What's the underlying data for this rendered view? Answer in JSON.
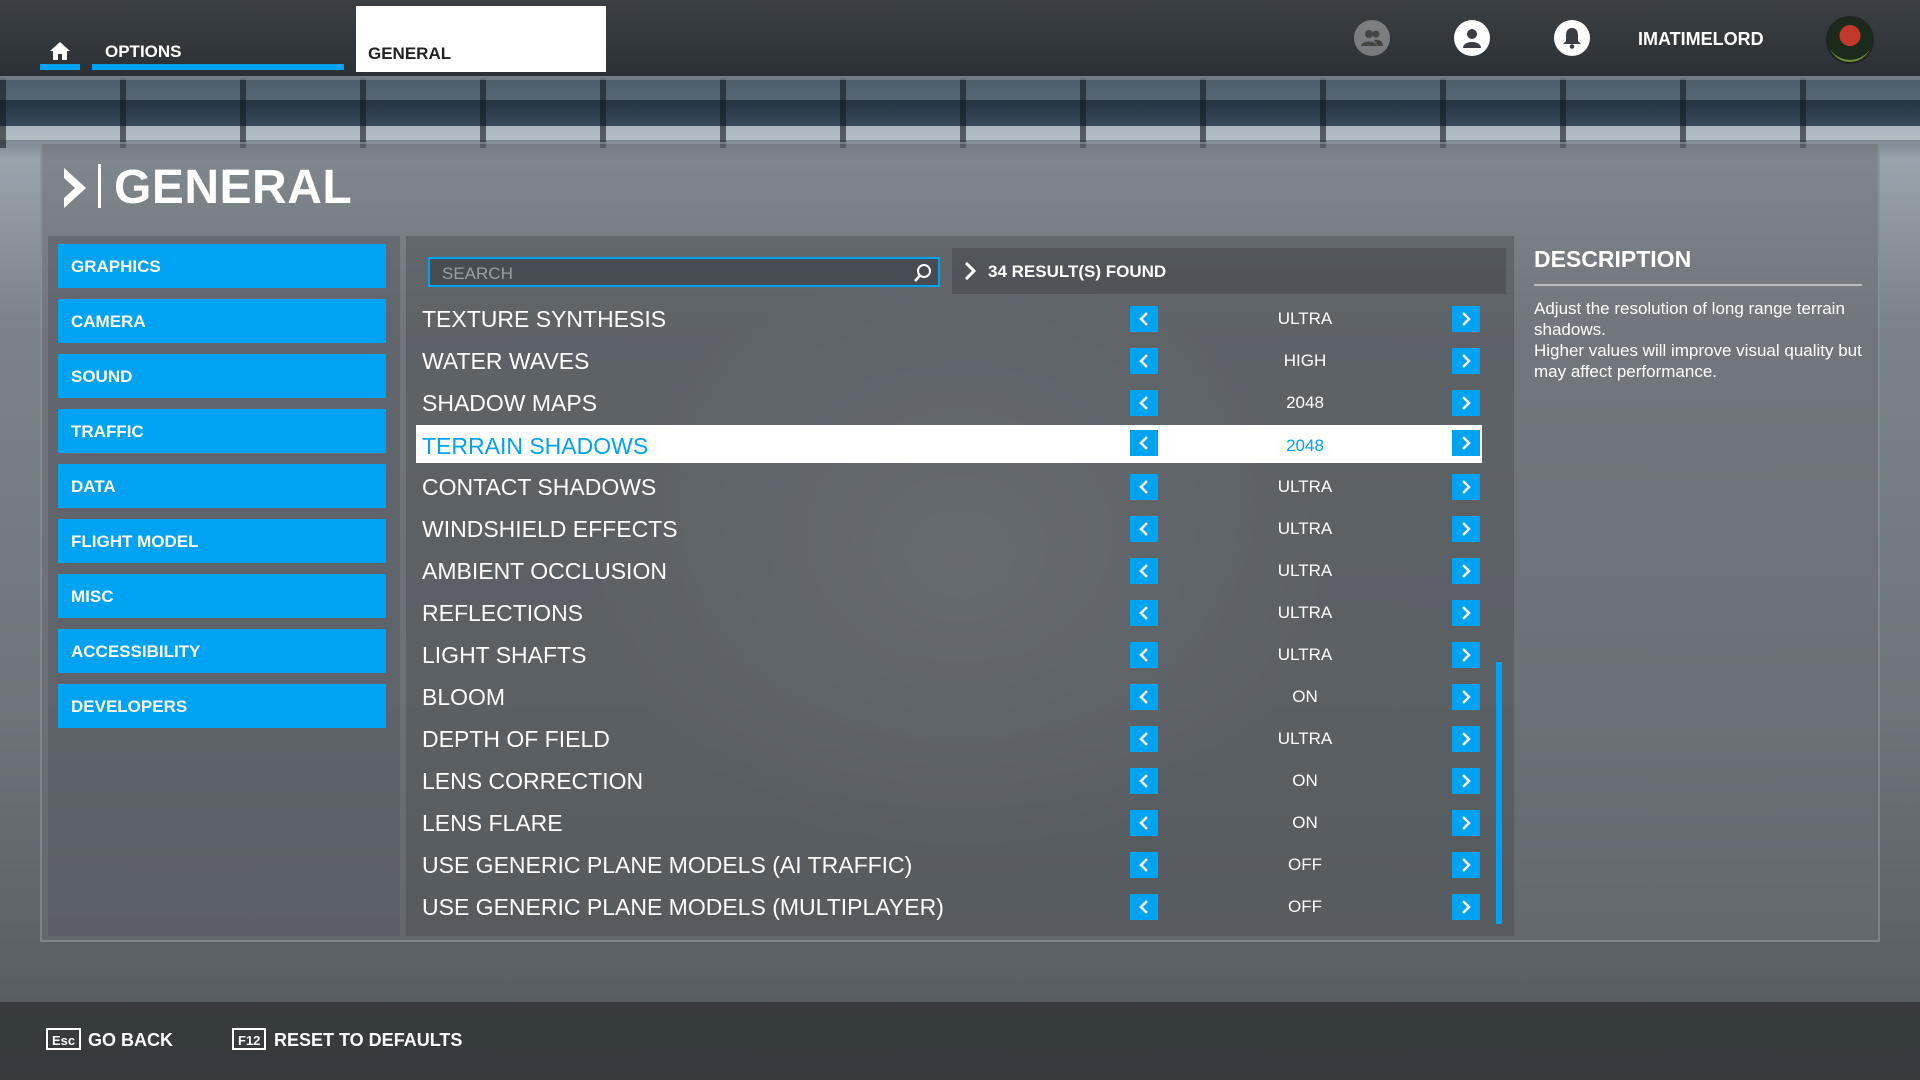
{
  "topbar": {
    "options_label": "OPTIONS",
    "active_tab_label": "GENERAL",
    "username": "IMATIMELORD"
  },
  "page": {
    "title": "GENERAL"
  },
  "sidebar": {
    "items": [
      {
        "label": "GRAPHICS",
        "active": true
      },
      {
        "label": "CAMERA"
      },
      {
        "label": "SOUND"
      },
      {
        "label": "TRAFFIC"
      },
      {
        "label": "DATA"
      },
      {
        "label": "FLIGHT MODEL"
      },
      {
        "label": "MISC"
      },
      {
        "label": "ACCESSIBILITY"
      },
      {
        "label": "DEVELOPERS"
      }
    ]
  },
  "search": {
    "placeholder": "SEARCH",
    "value": ""
  },
  "results": {
    "text": "34 RESULT(S) FOUND"
  },
  "settings": [
    {
      "label": "TEXTURE SYNTHESIS",
      "value": "ULTRA"
    },
    {
      "label": "WATER WAVES",
      "value": "HIGH"
    },
    {
      "label": "SHADOW MAPS",
      "value": "2048"
    },
    {
      "label": "TERRAIN SHADOWS",
      "value": "2048",
      "selected": true
    },
    {
      "label": "CONTACT SHADOWS",
      "value": "ULTRA"
    },
    {
      "label": "WINDSHIELD EFFECTS",
      "value": "ULTRA"
    },
    {
      "label": "AMBIENT OCCLUSION",
      "value": "ULTRA"
    },
    {
      "label": "REFLECTIONS",
      "value": "ULTRA"
    },
    {
      "label": "LIGHT SHAFTS",
      "value": "ULTRA"
    },
    {
      "label": "BLOOM",
      "value": "ON"
    },
    {
      "label": "DEPTH OF FIELD",
      "value": "ULTRA"
    },
    {
      "label": "LENS CORRECTION",
      "value": "ON"
    },
    {
      "label": "LENS FLARE",
      "value": "ON"
    },
    {
      "label": "USE GENERIC PLANE MODELS (AI TRAFFIC)",
      "value": "OFF"
    },
    {
      "label": "USE GENERIC PLANE MODELS (MULTIPLAYER)",
      "value": "OFF"
    }
  ],
  "description": {
    "title": "DESCRIPTION",
    "text": "Adjust the resolution of long range terrain shadows.\nHigher values will improve visual quality but may affect performance."
  },
  "footer": {
    "back_key": "Esc",
    "back_label": "GO BACK",
    "reset_key": "F12",
    "reset_label": "RESET TO DEFAULTS"
  },
  "scrollbar": {
    "position_fraction": 0.58
  },
  "colors": {
    "accent": "#00a2f2",
    "selected_row_bg": "#ffffff"
  },
  "icons": [
    "home-icon",
    "friends-icon",
    "profile-icon",
    "bell-icon",
    "avatar",
    "chevron-right-icon",
    "search-icon",
    "arrow-left-icon",
    "arrow-right-icon"
  ]
}
